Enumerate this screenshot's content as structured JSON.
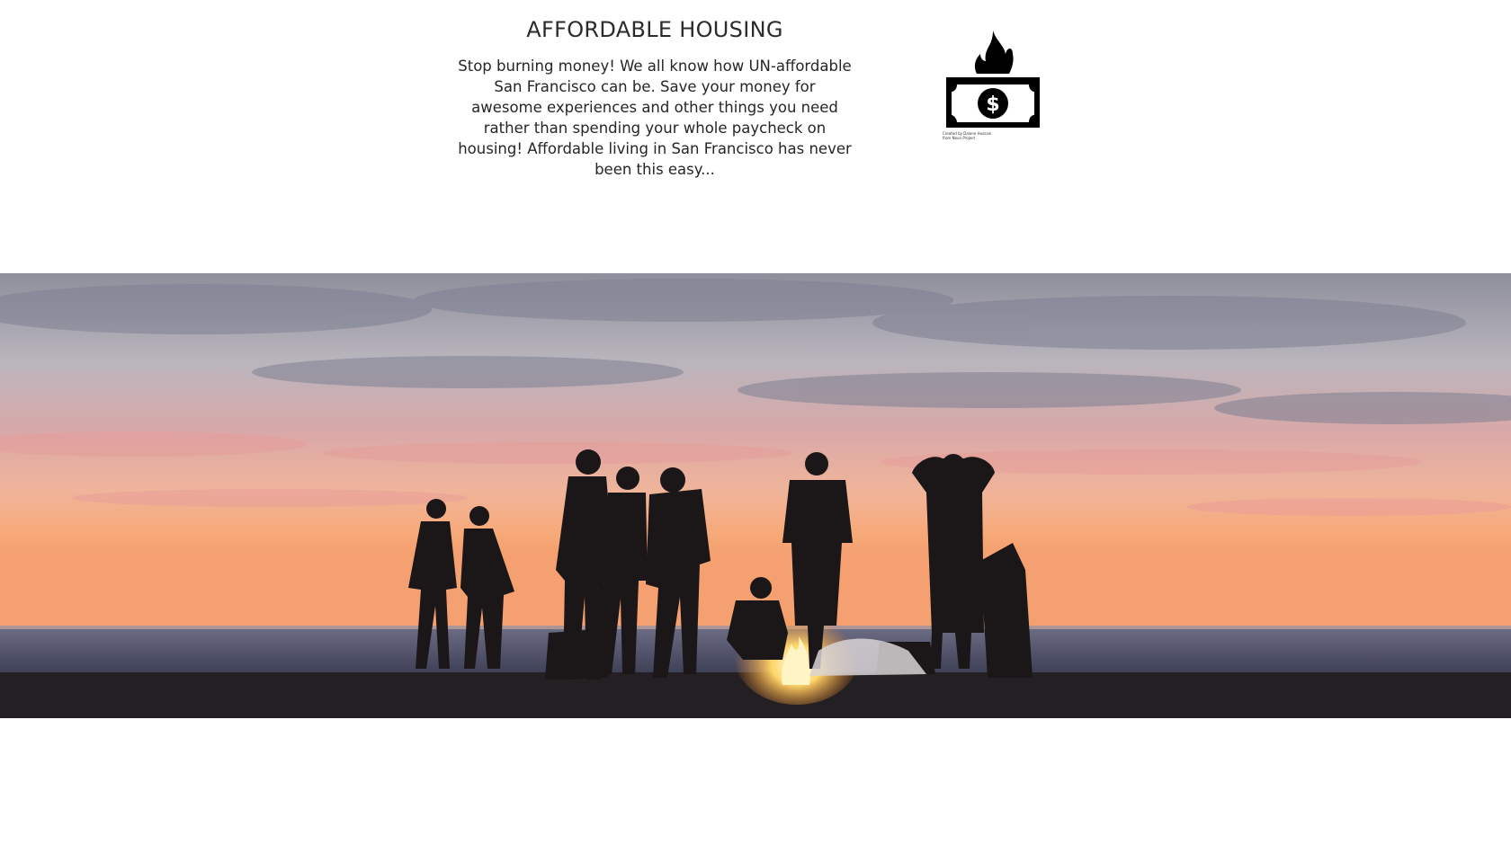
{
  "feature": {
    "title": "AFFORDABLE HOUSING",
    "body": "Stop burning money! We all know how UN-affordable San Francisco can be. Save your money for awesome experiences and other things you need rather than spending your whole paycheck on housing! Affordable living in San Francisco has never been this easy...",
    "icon": "burning-money-icon",
    "icon_credit_line1": "Created by Dalane Hussain",
    "icon_credit_line2": "from Noun Project"
  },
  "hero": {
    "image": "beach-bonfire-sunset-photo"
  },
  "colors": {
    "text": "#262626",
    "background": "#ffffff",
    "icon": "#000000"
  }
}
